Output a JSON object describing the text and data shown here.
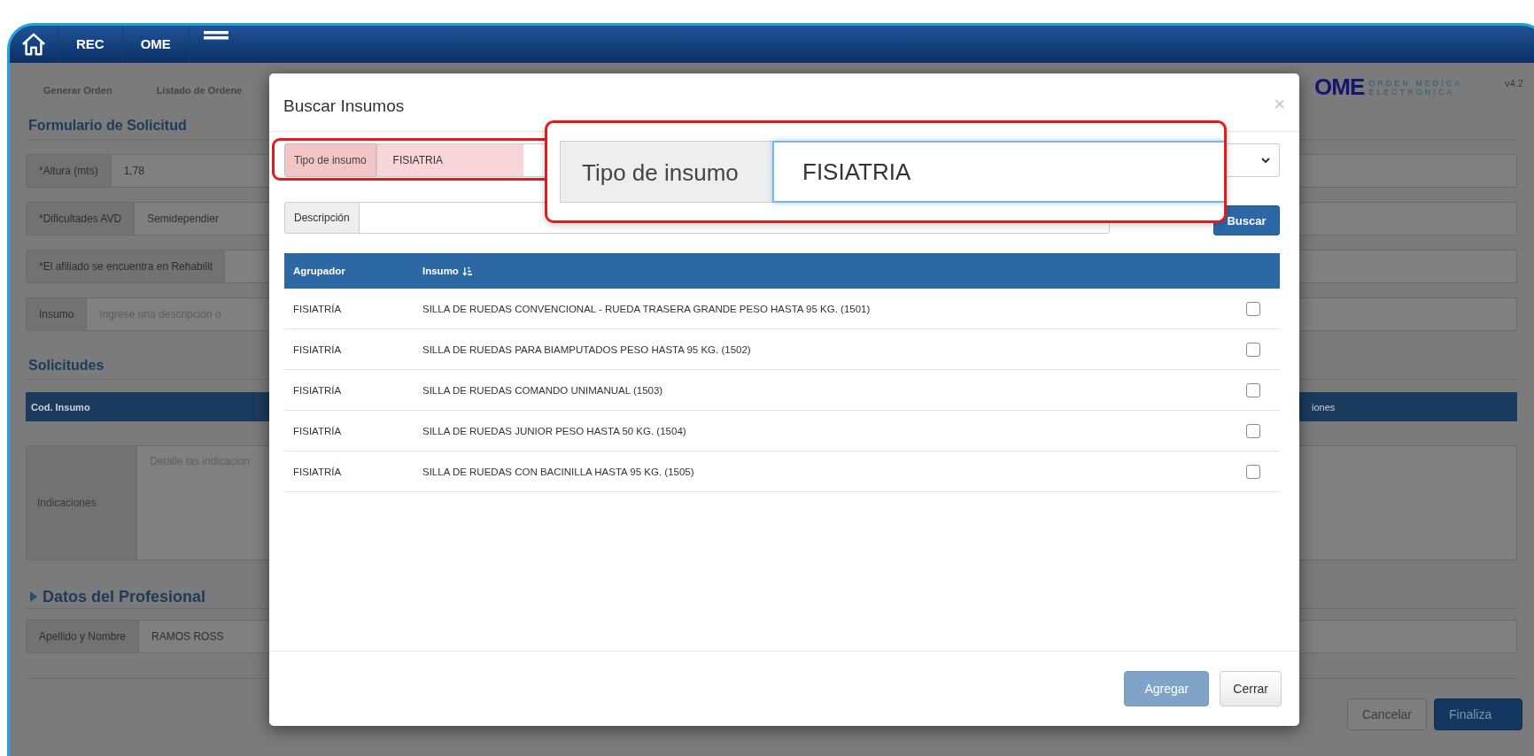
{
  "header": {
    "nav": [
      {
        "label": "REC"
      },
      {
        "label": "OME"
      }
    ]
  },
  "page": {
    "links": [
      "Generar Orden",
      "Listado de Ordene"
    ],
    "logo": {
      "mark": "OME",
      "line_1": "ORDEN MEDICA",
      "line_2": "ELECTRONICA"
    },
    "version": "v4.2",
    "section_title": "Formulario de Solicitud",
    "fields": [
      {
        "label": "*Altura (mts)",
        "value": "1,78"
      },
      {
        "label": "*Dificultades AVD",
        "value": "Semidependier"
      },
      {
        "label": "*El afiliado se encuentra en Rehabilit"
      },
      {
        "label": "Insumo",
        "placeholder": "Ingrese una descripción o"
      }
    ],
    "requests_title": "Solicitudes",
    "requests_columns": [
      "Cod. Insumo",
      "iones"
    ],
    "indications": {
      "label": "Indicaciones",
      "placeholder": "Detalle las indicacion"
    },
    "professional_title": "Datos del Profesional",
    "professional": {
      "label": "Apellido y Nombre",
      "value": "RAMOS ROSS"
    },
    "buttons": [
      "Cancelar",
      "Finaliza"
    ]
  },
  "modal": {
    "title": "Buscar Insumos",
    "close": "×",
    "type_field": {
      "label": "Tipo de insumo",
      "value": "FISIATRIA"
    },
    "description": {
      "label": "Descripción"
    },
    "search_button": "Buscar",
    "columns": [
      "Agrupador",
      "Insumo"
    ],
    "rows": [
      {
        "group": "FISIATRÍA",
        "item": "SILLA DE RUEDAS CONVENCIONAL - RUEDA TRASERA GRANDE PESO HASTA 95 KG. (1501)",
        "checked": false
      },
      {
        "group": "FISIATRÍA",
        "item": "SILLA DE RUEDAS PARA BIAMPUTADOS PESO HASTA 95 KG. (1502)",
        "checked": false
      },
      {
        "group": "FISIATRÍA",
        "item": "SILLA DE RUEDAS COMANDO UNIMANUAL (1503)",
        "checked": false
      },
      {
        "group": "FISIATRÍA",
        "item": "SILLA DE RUEDAS JUNIOR PESO HASTA 50 KG. (1504)",
        "checked": false
      },
      {
        "group": "FISIATRÍA",
        "item": "SILLA DE RUEDAS CON BACINILLA HASTA 95 KG. (1505)",
        "checked": false
      }
    ],
    "buttons": [
      "Agregar",
      "Cerrar"
    ]
  },
  "callout": {
    "label": "Tipo de insumo",
    "value": "FISIATRIA"
  }
}
